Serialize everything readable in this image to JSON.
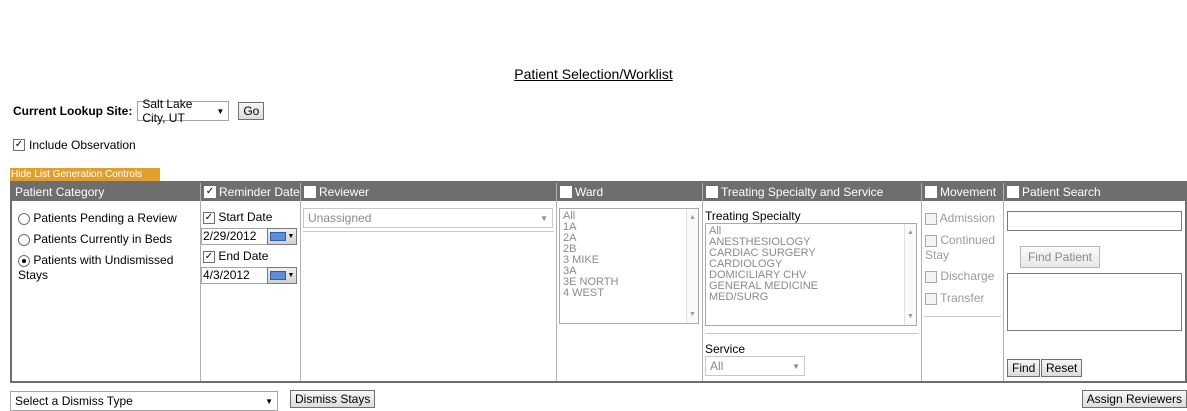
{
  "page": {
    "title": "Patient Selection/Worklist"
  },
  "lookup": {
    "label": "Current Lookup Site:",
    "site": "Salt Lake City, UT",
    "go_label": "Go"
  },
  "include_observation": {
    "label": "Include Observation",
    "checked": true
  },
  "hide_controls_label": "Hide List Generation Controls",
  "patient_category": {
    "header": "Patient Category",
    "options": [
      "Patients Pending a Review",
      "Patients Currently in Beds",
      "Patients with Undismissed Stays"
    ],
    "selected_index": 2
  },
  "reminder_date": {
    "header": "Reminder Date",
    "start_label": "Start Date",
    "start_value": "2/29/2012",
    "end_label": "End Date",
    "end_value": "4/3/2012"
  },
  "reviewer": {
    "header": "Reviewer",
    "value": "Unassigned"
  },
  "ward": {
    "header": "Ward",
    "items": [
      "All",
      "1A",
      "2A",
      "2B",
      "3 MIKE",
      "3A",
      "3E NORTH",
      "4 WEST"
    ]
  },
  "treating": {
    "header": "Treating Specialty and Service",
    "specialty_label": "Treating Specialty",
    "specialties": [
      "All",
      "ANESTHESIOLOGY",
      "CARDIAC SURGERY",
      "CARDIOLOGY",
      "DOMICILIARY CHV",
      "GENERAL MEDICINE",
      "MED/SURG"
    ],
    "service_label": "Service",
    "service_value": "All"
  },
  "movement": {
    "header": "Movement",
    "items": [
      "Admission",
      "Continued Stay",
      "Discharge",
      "Transfer"
    ]
  },
  "patient_search": {
    "header": "Patient Search",
    "find_patient_label": "Find Patient",
    "find_label": "Find",
    "reset_label": "Reset"
  },
  "bottom": {
    "dismiss_placeholder": "Select a Dismiss Type",
    "dismiss_label": "Dismiss Stays",
    "assign_label": "Assign Reviewers"
  }
}
